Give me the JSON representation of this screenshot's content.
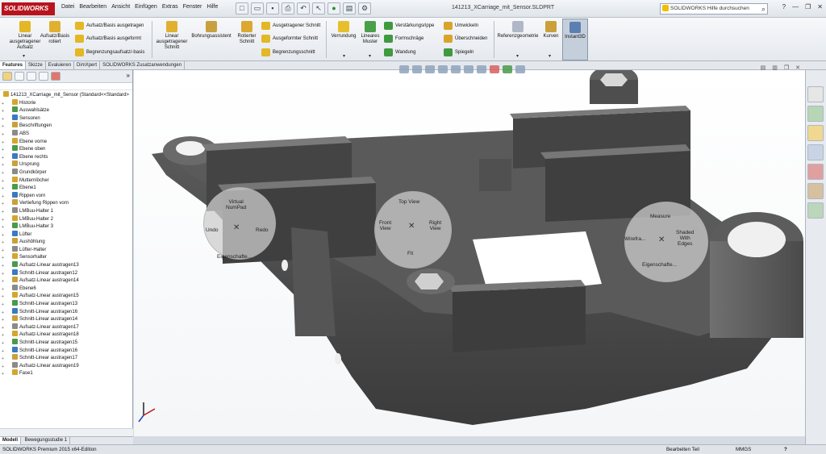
{
  "app": {
    "logo": "SOLIDWORKS",
    "window_title": "141213_XCarriage_mit_Sensor.SLDPRT",
    "search_placeholder": "SOLIDWORKS Hilfe durchsuchen",
    "help_label": "?",
    "menu": [
      "Datei",
      "Bearbeiten",
      "Ansicht",
      "Einfügen",
      "Extras",
      "Fenster",
      "Hilfe"
    ]
  },
  "ribbon": {
    "big": [
      {
        "label": "Linear\nausgetragener\nAufsatz",
        "icon": "linear-boss-icon"
      },
      {
        "label": "Aufsatz/Basis\nrotiert",
        "icon": "revolve-boss-icon"
      },
      {
        "label": "Linear\nausgetragener\nSchnitt",
        "icon": "linear-cut-icon"
      },
      {
        "label": "Bohrungsassistent",
        "icon": "hole-wizard-icon"
      },
      {
        "label": "Rotierter\nSchnitt",
        "icon": "revolve-cut-icon"
      },
      {
        "label": "Verrundung",
        "icon": "fillet-icon"
      },
      {
        "label": "Lineares\nMuster",
        "icon": "linear-pattern-icon"
      },
      {
        "label": "Referenzgeometrie",
        "icon": "ref-geometry-icon"
      },
      {
        "label": "Kurven",
        "icon": "curves-icon"
      },
      {
        "label": "Instant3D",
        "icon": "instant3d-icon"
      }
    ],
    "small_a": [
      "Aufsatz/Basis ausgetragen",
      "Aufsatz/Basis ausgeformt",
      "Begrenzungsaufsatz/-basis"
    ],
    "small_b": [
      "Ausgetragener Schnitt",
      "Ausgeformter Schnitt",
      "Begrenzungsschnitt"
    ],
    "small_c": [
      "Verstärkungsrippe",
      "Formschräge",
      "Wandung"
    ],
    "small_d": [
      "Umwickeln",
      "Überschneiden",
      "Spiegeln"
    ]
  },
  "tabs": [
    "Features",
    "Skizze",
    "Evaluieren",
    "DimXpert",
    "SOLIDWORKS Zusatzanwendungen"
  ],
  "tree": {
    "root": "141213_XCarriage_mit_Sensor (Standard<<Standard>",
    "items": [
      "Historie",
      "Auswahlsätze",
      "Sensoren",
      "Beschriftungen",
      "ABS",
      "Ebene vorne",
      "Ebene oben",
      "Ebene rechts",
      "Ursprung",
      "Grundkörper",
      "Mutternlöcher",
      "Ebene1",
      "Rippen vorn",
      "Vertiefung Rippen vorn",
      "LMBuu-Halter 1",
      "LMBuu-Halter 2",
      "LMBuu-Halter 3",
      "Lüfter",
      "Aushöhlung",
      "Lüfter-Halter",
      "Sensorhalter",
      "Aufsatz-Linear austragen13",
      "Schnitt-Linear austragen12",
      "Aufsatz-Linear austragen14",
      "Ebene6",
      "Aufsatz-Linear austragen15",
      "Schnitt-Linear austragen13",
      "Schnitt-Linear austragen16",
      "Schnitt-Linear austragen14",
      "Aufsatz-Linear austragen17",
      "Aufsatz-Linear austragen18",
      "Schnitt-Linear austragen15",
      "Schnitt-Linear austragen16",
      "Schnitt-Linear austragen17",
      "Aufsatz-Linear austragen19",
      "Fase1"
    ]
  },
  "bottom_tabs": [
    "Modell",
    "Bewegungsstudie 1"
  ],
  "status": {
    "product": "SOLIDWORKS Premium 2015 x64-Edition",
    "mode": "Bearbeiten Teil",
    "units": "MMGS",
    "help": "?"
  },
  "gestures": {
    "left": {
      "top": "Virtual\nNumPad",
      "left": "Undo",
      "right": "Redo",
      "bottom": "Eigenschafte..."
    },
    "center": {
      "top": "Top View",
      "left": "Front\nView",
      "right": "Right\nView",
      "bottom": "Fit"
    },
    "right": {
      "top": "Measure",
      "left": "Wirefra...",
      "right": "Shaded\nWith\nEdges",
      "bottom": "Eigenschafte..."
    }
  },
  "colors": {
    "brand": "#b8141e",
    "model_dark": "#4a4a4a",
    "model_face": "#6a6a6a",
    "viewport_bg": "#ffffff"
  }
}
